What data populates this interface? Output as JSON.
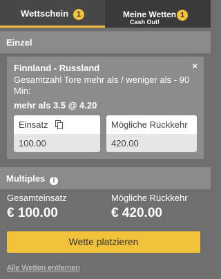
{
  "tabs": [
    {
      "label": "Wettschein",
      "count": "1"
    },
    {
      "label": "Meine Wetten",
      "count": "1",
      "sublabel": "Cash Out!"
    }
  ],
  "einzel": {
    "heading": "Einzel",
    "bet": {
      "match": "Finnland - Russland",
      "market": "Gesamtzahl Tore mehr als / weniger als - 90 Min:",
      "selection": "mehr als 3.5 @ 4.20",
      "close_symbol": "×",
      "stake_label": "Einsatz",
      "stake_value": "100.00",
      "return_label": "Mögliche Rückkehr",
      "return_value": "420.00"
    }
  },
  "multiples": {
    "heading": "Multiples",
    "info_symbol": "i",
    "total_stake_label": "Gesamteinsatz",
    "total_stake_value": "€ 100.00",
    "potential_return_label": "Mögliche Rückkehr",
    "potential_return_value": "€ 420.00"
  },
  "actions": {
    "place_bet": "Wette platzieren",
    "remove_all": "Alle Wetten entfernen"
  },
  "colors": {
    "accent": "#f2c23a",
    "background": "#6f6f6f",
    "tabbar": "#3a3a3a",
    "section_header": "#8a8a8a"
  },
  "icons": {
    "close": "close-icon",
    "copy": "copy-icon",
    "info": "info-icon"
  }
}
